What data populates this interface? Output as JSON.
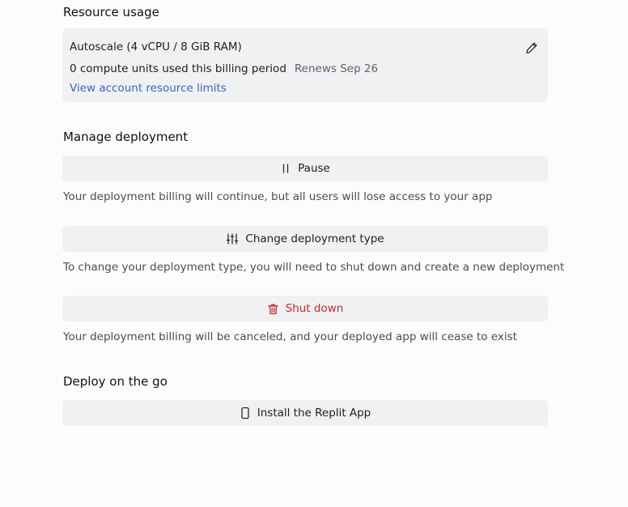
{
  "resource_usage": {
    "heading": "Resource usage",
    "plan": "Autoscale (4 vCPU / 8 GiB RAM)",
    "usage": "0 compute units used this billing period",
    "renews": "Renews Sep 26",
    "limits_link": "View account resource limits",
    "edit_icon": "pencil-icon"
  },
  "manage_deployment": {
    "heading": "Manage deployment",
    "pause": {
      "label": "Pause",
      "icon": "pause-icon",
      "description": "Your deployment billing will continue, but all users will lose access to your app"
    },
    "change_type": {
      "label": "Change deployment type",
      "icon": "sliders-icon",
      "description": "To change your deployment type, you will need to shut down and create a new deployment"
    },
    "shut_down": {
      "label": "Shut down",
      "icon": "trash-icon",
      "description": "Your deployment billing will be canceled, and your deployed app will cease to exist",
      "color": "#c42b2b"
    }
  },
  "deploy_on_the_go": {
    "heading": "Deploy on the go",
    "install_app": {
      "label": "Install the Replit App",
      "icon": "phone-icon"
    }
  }
}
